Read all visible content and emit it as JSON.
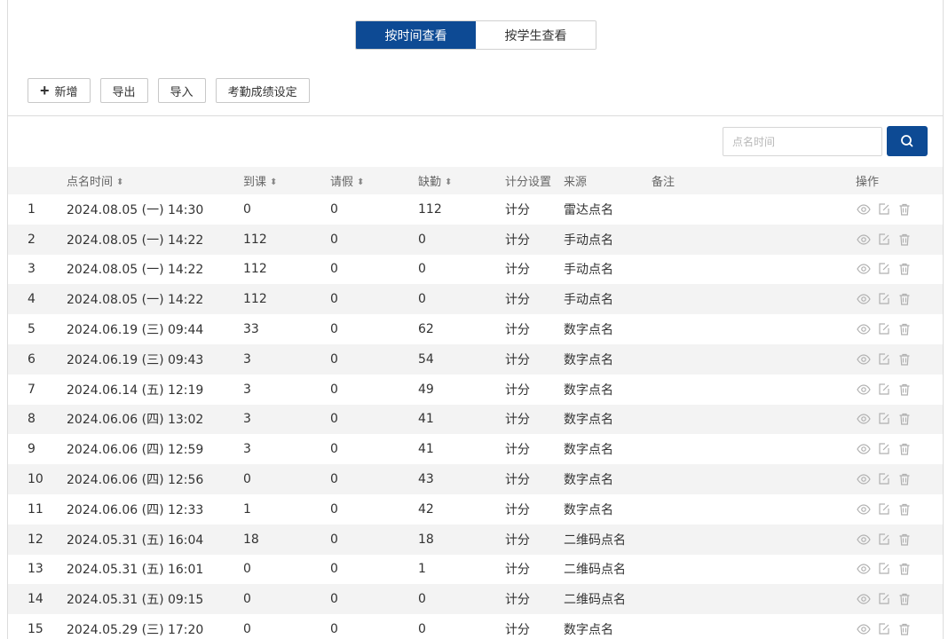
{
  "view_tabs": [
    {
      "label": "按时间查看",
      "active": true
    },
    {
      "label": "按学生查看",
      "active": false
    }
  ],
  "toolbar": {
    "add_label": "新增",
    "export_label": "导出",
    "import_label": "导入",
    "settings_label": "考勤成绩设定"
  },
  "search": {
    "placeholder": "点名时间",
    "icon": "search-icon"
  },
  "colors": {
    "accent": "#0d4a94",
    "row_alt": "#f3f3f3",
    "icon_gray": "#b0b0b0"
  },
  "table": {
    "headers": {
      "time": "点名时间",
      "present": "到课",
      "leave": "请假",
      "absent": "缺勤",
      "score": "计分设置",
      "source": "来源",
      "remark": "备注",
      "ops": "操作"
    },
    "rows": [
      {
        "idx": "1",
        "time": "2024.08.05 (一) 14:30",
        "present": "0",
        "leave": "0",
        "absent": "112",
        "score": "计分",
        "source": "雷达点名",
        "remark": ""
      },
      {
        "idx": "2",
        "time": "2024.08.05 (一) 14:22",
        "present": "112",
        "leave": "0",
        "absent": "0",
        "score": "计分",
        "source": "手动点名",
        "remark": ""
      },
      {
        "idx": "3",
        "time": "2024.08.05 (一) 14:22",
        "present": "112",
        "leave": "0",
        "absent": "0",
        "score": "计分",
        "source": "手动点名",
        "remark": ""
      },
      {
        "idx": "4",
        "time": "2024.08.05 (一) 14:22",
        "present": "112",
        "leave": "0",
        "absent": "0",
        "score": "计分",
        "source": "手动点名",
        "remark": ""
      },
      {
        "idx": "5",
        "time": "2024.06.19 (三) 09:44",
        "present": "33",
        "leave": "0",
        "absent": "62",
        "score": "计分",
        "source": "数字点名",
        "remark": ""
      },
      {
        "idx": "6",
        "time": "2024.06.19 (三) 09:43",
        "present": "3",
        "leave": "0",
        "absent": "54",
        "score": "计分",
        "source": "数字点名",
        "remark": ""
      },
      {
        "idx": "7",
        "time": "2024.06.14 (五) 12:19",
        "present": "3",
        "leave": "0",
        "absent": "49",
        "score": "计分",
        "source": "数字点名",
        "remark": ""
      },
      {
        "idx": "8",
        "time": "2024.06.06 (四) 13:02",
        "present": "3",
        "leave": "0",
        "absent": "41",
        "score": "计分",
        "source": "数字点名",
        "remark": ""
      },
      {
        "idx": "9",
        "time": "2024.06.06 (四) 12:59",
        "present": "3",
        "leave": "0",
        "absent": "41",
        "score": "计分",
        "source": "数字点名",
        "remark": ""
      },
      {
        "idx": "10",
        "time": "2024.06.06 (四) 12:56",
        "present": "0",
        "leave": "0",
        "absent": "43",
        "score": "计分",
        "source": "数字点名",
        "remark": ""
      },
      {
        "idx": "11",
        "time": "2024.06.06 (四) 12:33",
        "present": "1",
        "leave": "0",
        "absent": "42",
        "score": "计分",
        "source": "数字点名",
        "remark": ""
      },
      {
        "idx": "12",
        "time": "2024.05.31 (五) 16:04",
        "present": "18",
        "leave": "0",
        "absent": "18",
        "score": "计分",
        "source": "二维码点名",
        "remark": ""
      },
      {
        "idx": "13",
        "time": "2024.05.31 (五) 16:01",
        "present": "0",
        "leave": "0",
        "absent": "1",
        "score": "计分",
        "source": "二维码点名",
        "remark": ""
      },
      {
        "idx": "14",
        "time": "2024.05.31 (五) 09:15",
        "present": "0",
        "leave": "0",
        "absent": "0",
        "score": "计分",
        "source": "二维码点名",
        "remark": ""
      },
      {
        "idx": "15",
        "time": "2024.05.29 (三) 17:20",
        "present": "0",
        "leave": "0",
        "absent": "0",
        "score": "计分",
        "source": "数字点名",
        "remark": ""
      }
    ],
    "row_icons": [
      "eye-icon",
      "edit-icon",
      "trash-icon"
    ]
  }
}
